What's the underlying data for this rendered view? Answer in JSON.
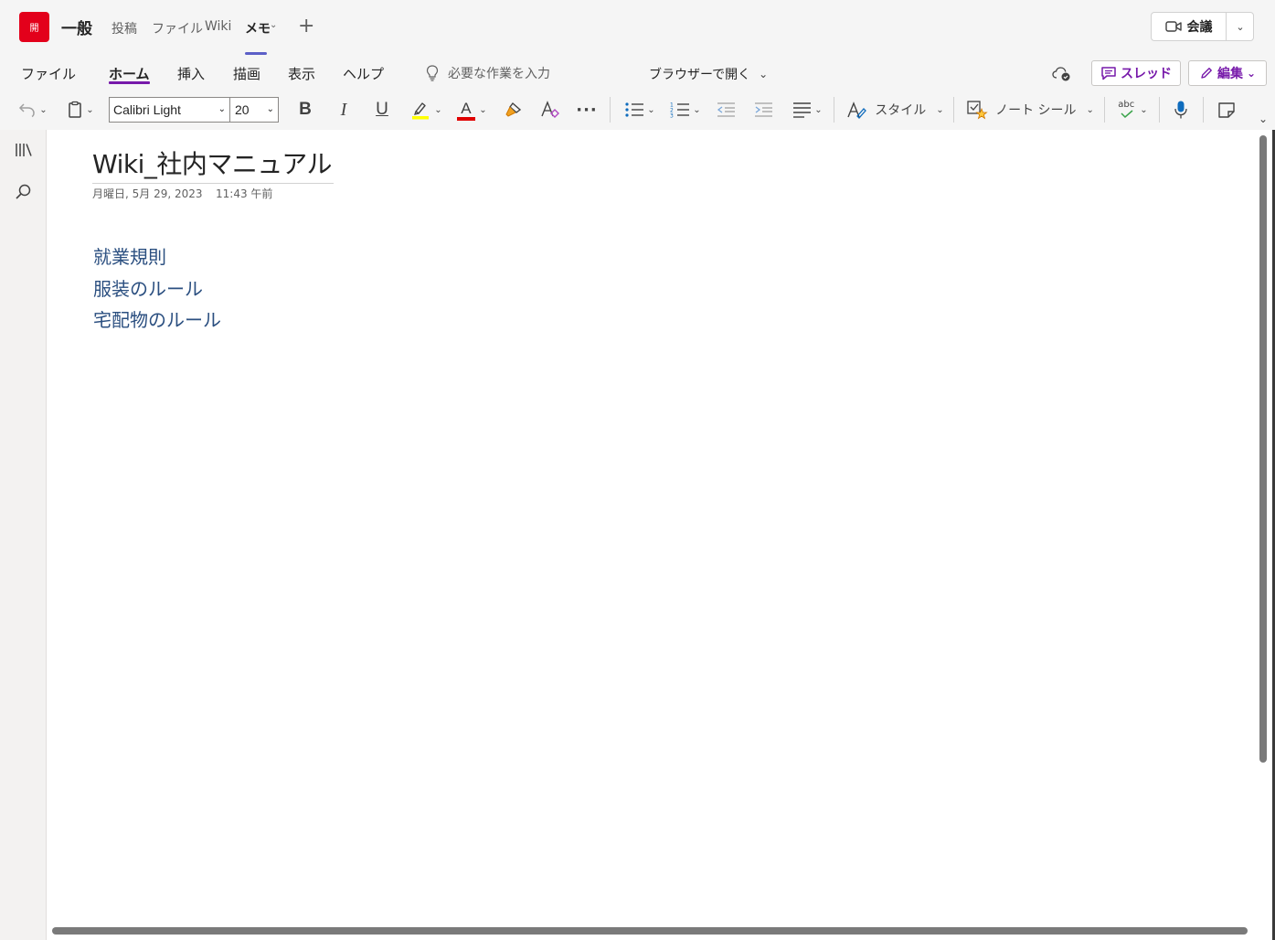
{
  "teams": {
    "channel_avatar": "開",
    "channel_name": "一般",
    "tabs": [
      {
        "label": "投稿"
      },
      {
        "label": "ファイル"
      },
      {
        "label": "Wiki"
      },
      {
        "label": "メモ"
      }
    ],
    "meeting_label": "会議"
  },
  "menu": {
    "items": [
      {
        "label": "ファイル"
      },
      {
        "label": "ホーム"
      },
      {
        "label": "挿入"
      },
      {
        "label": "描画"
      },
      {
        "label": "表示"
      },
      {
        "label": "ヘルプ"
      }
    ],
    "tell_me": "必要な作業を入力",
    "open_in_browser": "ブラウザーで開く",
    "thread_label": "スレッド",
    "edit_label": "編集"
  },
  "toolbar": {
    "font_name": "Calibri Light",
    "font_size": "20",
    "bold": "B",
    "italic": "I",
    "underline": "U",
    "font_color_letter": "A",
    "more": "···",
    "styles_label": "スタイル",
    "tags_label": "ノート シール",
    "spell_label": "abc",
    "highlight_color": "#ffff00",
    "font_color": "#e00000"
  },
  "page": {
    "title": "Wiki_社内マニュアル",
    "date": "月曜日, 5月 29, 2023",
    "time": "11:43 午前",
    "links": [
      {
        "label": "就業規則"
      },
      {
        "label": "服装のルール"
      },
      {
        "label": "宅配物のルール"
      }
    ]
  }
}
